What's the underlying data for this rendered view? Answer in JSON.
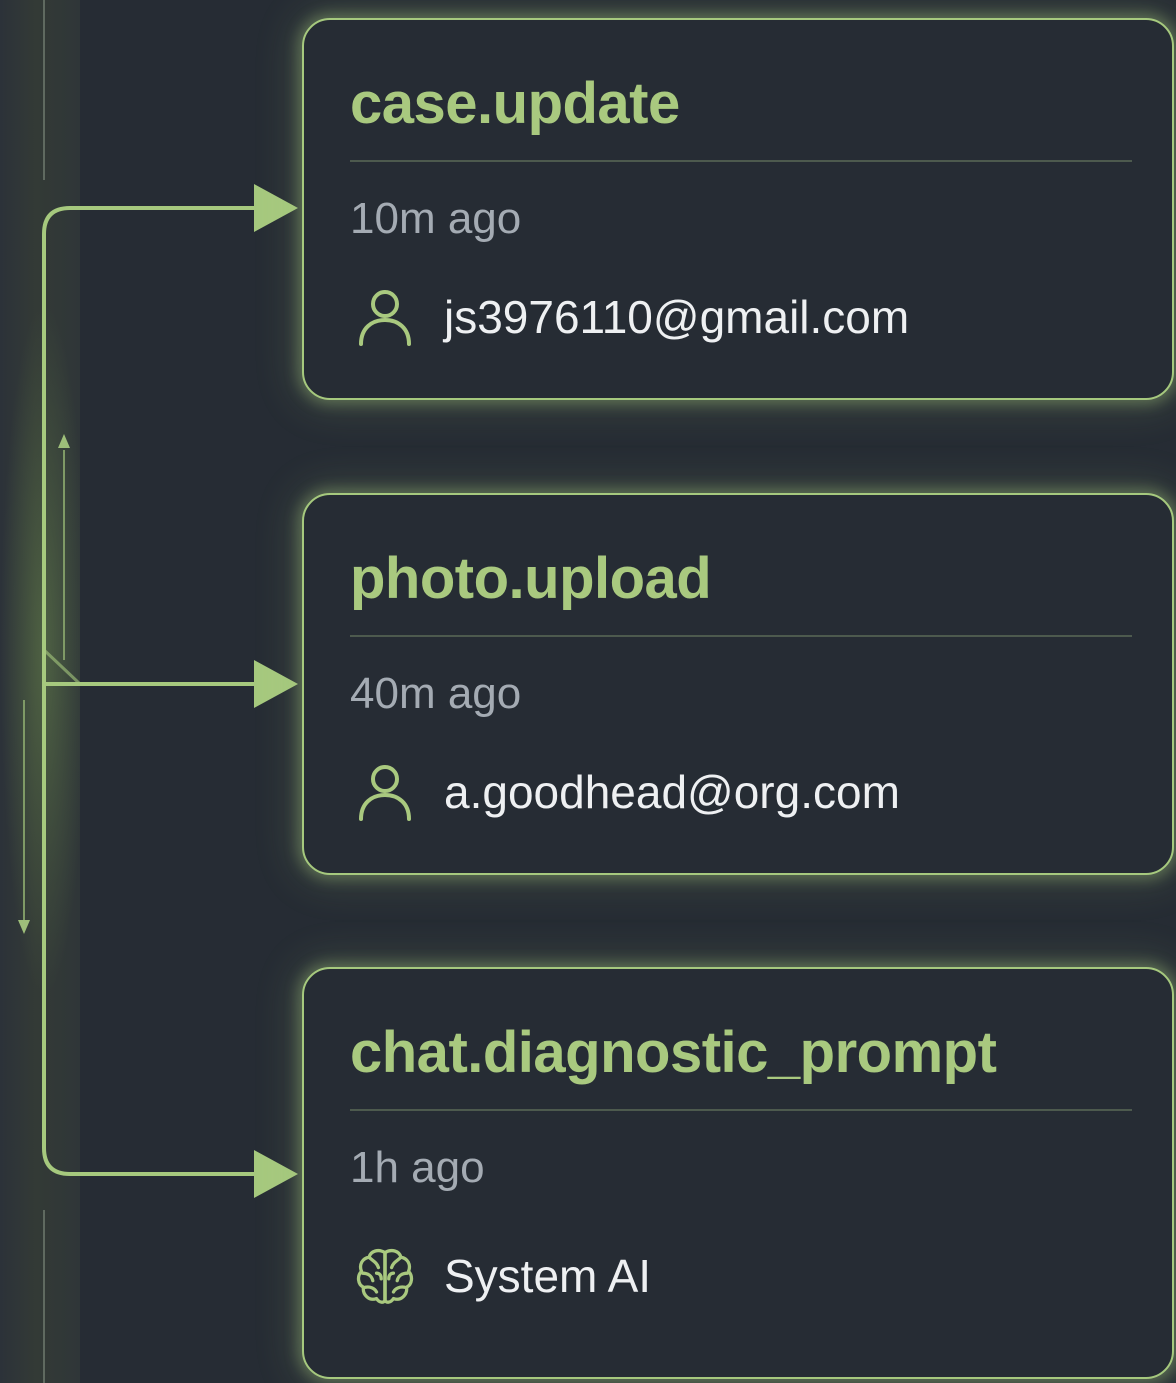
{
  "events": [
    {
      "title": "case.update",
      "time": "10m ago",
      "actor": {
        "icon": "user-icon",
        "name": "js3976110@gmail.com"
      }
    },
    {
      "title": "photo.upload",
      "time": "40m ago",
      "actor": {
        "icon": "user-icon",
        "name": "a.goodhead@org.com"
      }
    },
    {
      "title": "chat.diagnostic_prompt",
      "time": "1h ago",
      "actor": {
        "icon": "brain-icon",
        "name": "System AI"
      }
    }
  ],
  "colors": {
    "background": "#262c34",
    "accent": "#a9c97f",
    "muted_text": "#a4abb3",
    "primary_text": "#eef0f2"
  }
}
